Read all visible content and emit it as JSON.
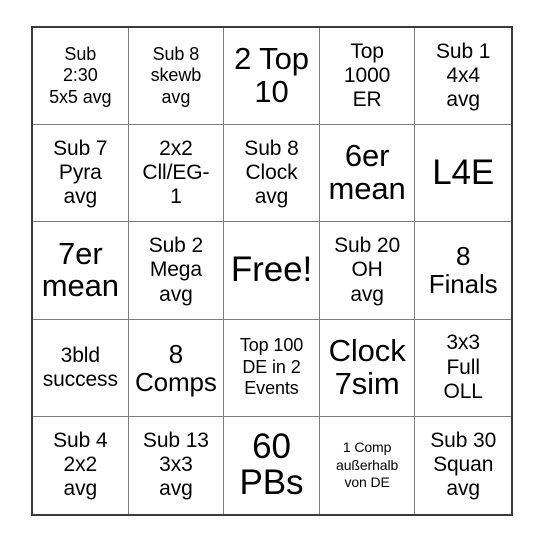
{
  "card": {
    "title": "Bingo Card",
    "columns": 5,
    "rows": 5,
    "colors": {
      "background": "#ffffff",
      "text": "#000000",
      "outer_border": "#3a3a3a",
      "cell_border": "#7d7d7d"
    },
    "cells": [
      {
        "id": "r1c1",
        "text": "Sub\n2:30\n5x5 avg",
        "size": "sm",
        "row": 1,
        "col": 1
      },
      {
        "id": "r1c2",
        "text": "Sub 8\nskewb\navg",
        "size": "sm",
        "row": 1,
        "col": 2
      },
      {
        "id": "r1c3",
        "text": "2 Top\n10",
        "size": "xl",
        "row": 1,
        "col": 3
      },
      {
        "id": "r1c4",
        "text": "Top\n1000\nER",
        "size": "md",
        "row": 1,
        "col": 4
      },
      {
        "id": "r1c5",
        "text": "Sub 1\n4x4\navg",
        "size": "md",
        "row": 1,
        "col": 5
      },
      {
        "id": "r2c1",
        "text": "Sub 7\nPyra\navg",
        "size": "md",
        "row": 2,
        "col": 1
      },
      {
        "id": "r2c2",
        "text": "2x2\nCll/EG-\n1",
        "size": "md",
        "row": 2,
        "col": 2
      },
      {
        "id": "r2c3",
        "text": "Sub 8\nClock\navg",
        "size": "md",
        "row": 2,
        "col": 3
      },
      {
        "id": "r2c4",
        "text": "6er\nmean",
        "size": "xl",
        "row": 2,
        "col": 4
      },
      {
        "id": "r2c5",
        "text": "L4E",
        "size": "xxl",
        "row": 2,
        "col": 5
      },
      {
        "id": "r3c1",
        "text": "7er\nmean",
        "size": "xl",
        "row": 3,
        "col": 1
      },
      {
        "id": "r3c2",
        "text": "Sub 2\nMega\navg",
        "size": "md",
        "row": 3,
        "col": 2
      },
      {
        "id": "r3c3",
        "text": "Free!",
        "size": "xxl",
        "row": 3,
        "col": 3
      },
      {
        "id": "r3c4",
        "text": "Sub 20\nOH\navg",
        "size": "md",
        "row": 3,
        "col": 4
      },
      {
        "id": "r3c5",
        "text": "8\nFinals",
        "size": "lg",
        "row": 3,
        "col": 5
      },
      {
        "id": "r4c1",
        "text": "3bld\nsuccess",
        "size": "md",
        "row": 4,
        "col": 1
      },
      {
        "id": "r4c2",
        "text": "8\nComps",
        "size": "lg",
        "row": 4,
        "col": 2
      },
      {
        "id": "r4c3",
        "text": "Top 100\nDE in 2\nEvents",
        "size": "sm",
        "row": 4,
        "col": 3
      },
      {
        "id": "r4c4",
        "text": "Clock\n7sim",
        "size": "xl",
        "row": 4,
        "col": 4
      },
      {
        "id": "r4c5",
        "text": "3x3\nFull\nOLL",
        "size": "md",
        "row": 4,
        "col": 5
      },
      {
        "id": "r5c1",
        "text": "Sub 4\n2x2\navg",
        "size": "md",
        "row": 5,
        "col": 1
      },
      {
        "id": "r5c2",
        "text": "Sub 13\n3x3\navg",
        "size": "md",
        "row": 5,
        "col": 2
      },
      {
        "id": "r5c3",
        "text": "60\nPBs",
        "size": "xxl",
        "row": 5,
        "col": 3
      },
      {
        "id": "r5c4",
        "text": "1 Comp\naußerhalb\nvon DE",
        "size": "xs",
        "row": 5,
        "col": 4
      },
      {
        "id": "r5c5",
        "text": "Sub 30\nSquan\navg",
        "size": "md",
        "row": 5,
        "col": 5
      }
    ]
  }
}
